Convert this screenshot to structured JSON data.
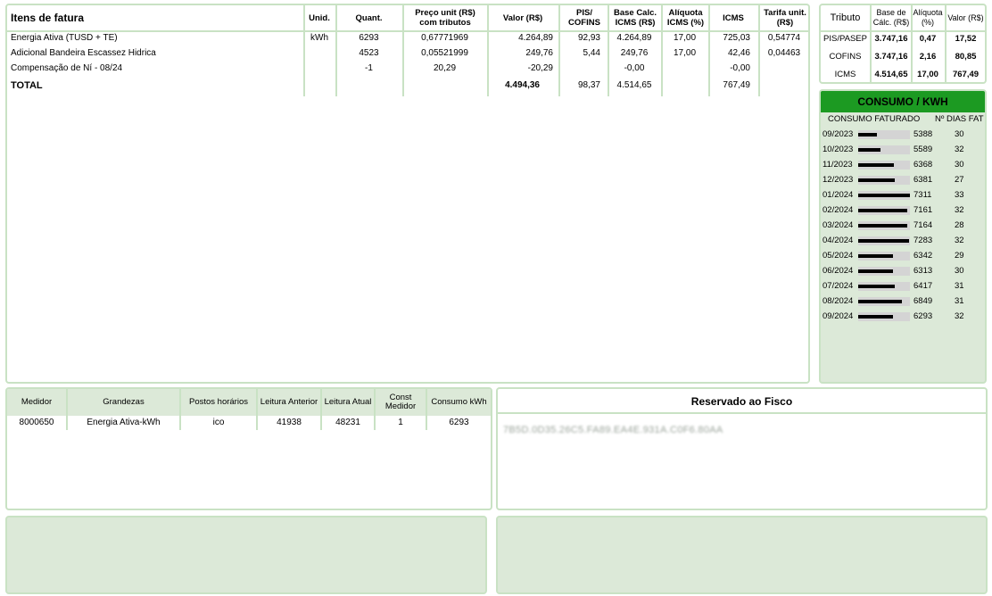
{
  "items": {
    "headers": {
      "item": "Itens de fatura",
      "unid": "Unid.",
      "quant": "Quant.",
      "preco": "Preço unit (R$) com tributos",
      "valor": "Valor (R$)",
      "pis": "PIS/ COFINS",
      "base": "Base Calc. ICMS (R$)",
      "aliq": "Alíquota ICMS (%)",
      "icms": "ICMS",
      "tarifa": "Tarifa unit. (R$)"
    },
    "rows": [
      {
        "item": "Energia Ativa (TUSD + TE)",
        "unid": "kWh",
        "quant": "6293",
        "preco": "0,67771969",
        "valor": "4.264,89",
        "pis": "92,93",
        "base": "4.264,89",
        "aliq": "17,00",
        "icms": "725,03",
        "tarifa": "0,54774"
      },
      {
        "item": "Adicional Bandeira Escassez Hidrica",
        "unid": "",
        "quant": "4523",
        "preco": "0,05521999",
        "valor": "249,76",
        "pis": "5,44",
        "base": "249,76",
        "aliq": "17,00",
        "icms": "42,46",
        "tarifa": "0,04463"
      },
      {
        "item": "Compensação de Ní - 08/24",
        "unid": "",
        "quant": "-1",
        "preco": "20,29",
        "valor": "-20,29",
        "pis": "",
        "base": "-0,00",
        "aliq": "",
        "icms": "-0,00",
        "tarifa": ""
      }
    ],
    "total": {
      "label": "TOTAL",
      "valor": "4.494,36",
      "pis": "98,37",
      "base": "4.514,65",
      "icms": "767,49"
    }
  },
  "tributo": {
    "headers": {
      "tributo": "Tributo",
      "base": "Base de Cálc. (R$)",
      "aliq": "Alíquota (%)",
      "valor": "Valor (R$)"
    },
    "rows": [
      {
        "name": "PIS/PASEP",
        "base": "3.747,16",
        "aliq": "0,47",
        "valor": "17,52"
      },
      {
        "name": "COFINS",
        "base": "3.747,16",
        "aliq": "2,16",
        "valor": "80,85"
      },
      {
        "name": "ICMS",
        "base": "4.514,65",
        "aliq": "17,00",
        "valor": "767,49"
      }
    ]
  },
  "consumo": {
    "title": "CONSUMO / KWH",
    "col_consumo": "CONSUMO FATURADO",
    "col_dias": "Nº DIAS FAT",
    "bar_color": "#000000",
    "header_color": "#1c9a22",
    "max_value": 7311,
    "rows": [
      {
        "month": "09/2023",
        "value": "5388",
        "days": "30",
        "level": 0.36
      },
      {
        "month": "10/2023",
        "value": "5589",
        "days": "32",
        "level": 0.43
      },
      {
        "month": "11/2023",
        "value": "6368",
        "days": "30",
        "level": 0.69
      },
      {
        "month": "12/2023",
        "value": "6381",
        "days": "27",
        "level": 0.7
      },
      {
        "month": "01/2024",
        "value": "7311",
        "days": "33",
        "level": 1.0
      },
      {
        "month": "02/2024",
        "value": "7161",
        "days": "32",
        "level": 0.95
      },
      {
        "month": "03/2024",
        "value": "7164",
        "days": "28",
        "level": 0.95
      },
      {
        "month": "04/2024",
        "value": "7283",
        "days": "32",
        "level": 0.99
      },
      {
        "month": "05/2024",
        "value": "6342",
        "days": "29",
        "level": 0.68
      },
      {
        "month": "06/2024",
        "value": "6313",
        "days": "30",
        "level": 0.67
      },
      {
        "month": "07/2024",
        "value": "6417",
        "days": "31",
        "level": 0.71
      },
      {
        "month": "08/2024",
        "value": "6849",
        "days": "31",
        "level": 0.85
      },
      {
        "month": "09/2024",
        "value": "6293",
        "days": "32",
        "level": 0.67
      }
    ]
  },
  "medidor": {
    "headers": {
      "medidor": "Medidor",
      "grandezas": "Grandezas",
      "postos": "Postos horários",
      "anterior": "Leitura Anterior",
      "atual": "Leitura Atual",
      "const": "Const Medidor",
      "consumo": "Consumo kWh"
    },
    "row": {
      "medidor": "8000650",
      "grandezas": "Energia Ativa-kWh",
      "postos": "ico",
      "anterior": "41938",
      "atual": "48231",
      "const": "1",
      "consumo": "6293"
    }
  },
  "fisco": {
    "title": "Reservado ao Fisco",
    "code": "7B5D.0D35.26C5.FA89.EA4E.931A.C0F6.80AA"
  }
}
